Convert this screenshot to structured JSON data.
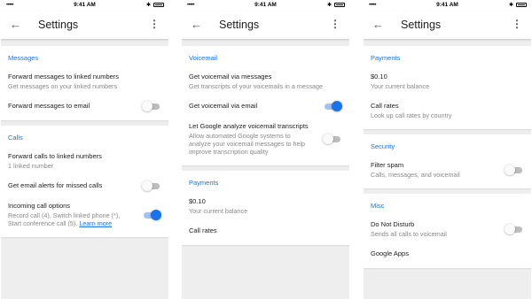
{
  "status": {
    "time": "9:41 AM",
    "signal": "•••••"
  },
  "panels": [
    {
      "title": "Settings",
      "sections": [
        {
          "header": "Messages",
          "rows": [
            {
              "title": "Forward messages to linked numbers",
              "sub": "Get messages on your linked numbers"
            },
            {
              "title": "Forward messages to email",
              "toggle": false
            }
          ]
        },
        {
          "header": "Calls",
          "rows": [
            {
              "title": "Forward calls to linked numbers",
              "sub": "1 linked number"
            },
            {
              "title": "Get email alerts for missed calls",
              "toggle": false
            },
            {
              "title": "Incoming call options",
              "sub": "Record call (4), Switch linked phone (*), Start conference call (5).",
              "link": "Learn more",
              "toggle": true
            }
          ]
        }
      ]
    },
    {
      "title": "Settings",
      "sections": [
        {
          "header": "Voicemail",
          "rows": [
            {
              "title": "Get voicemail via messages",
              "sub": "Get transcripts of your voicemails in a message"
            },
            {
              "title": "Get voicemail via email",
              "toggle": true
            },
            {
              "title": "Let Google analyze voicemail transcripts",
              "sub": "Allow automated Google systems to analyze your voicemail messages to help improve transcription quality",
              "toggle": false
            }
          ]
        },
        {
          "header": "Payments",
          "rows": [
            {
              "title": "$0.10",
              "sub": "Your current balance"
            },
            {
              "title": "Call rates",
              "sub": ""
            }
          ]
        }
      ]
    },
    {
      "title": "Settings",
      "sections": [
        {
          "header": "Payments",
          "rows": [
            {
              "title": "$0.10",
              "sub": "Your current balance"
            },
            {
              "title": "Call rates",
              "sub": "Look up call rates by country"
            }
          ]
        },
        {
          "header": "Security",
          "rows": [
            {
              "title": "Filter spam",
              "sub": "Calls, messages, and voicemail",
              "toggle": false
            }
          ]
        },
        {
          "header": "Misc",
          "rows": [
            {
              "title": "Do Not Disturb",
              "sub": "Sends all calls to voicemail",
              "toggle": false
            },
            {
              "title": "Google Apps",
              "sub": ""
            }
          ]
        }
      ]
    }
  ],
  "colors": {
    "accent": "#1a73e8",
    "toggle_off": "#bdbdbd",
    "background": "#eeeeee"
  },
  "icons": {
    "back": "arrow-back-icon",
    "more": "more-vert-icon"
  }
}
